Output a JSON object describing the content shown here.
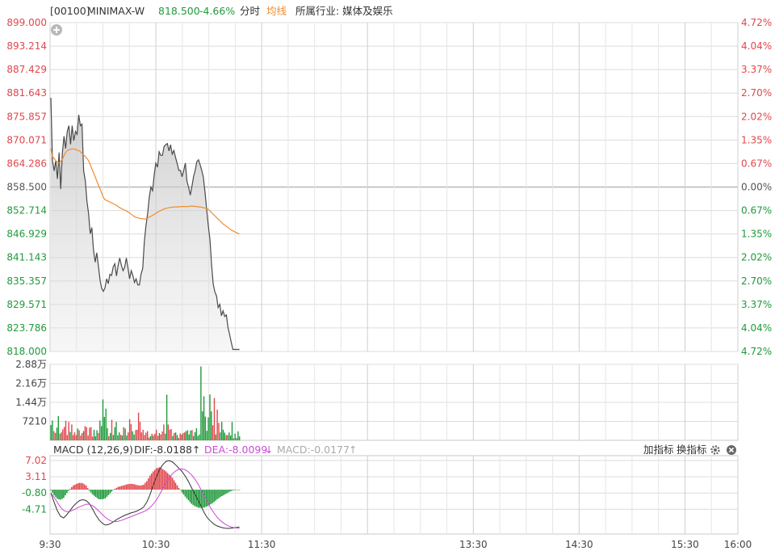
{
  "header": {
    "code": "[00100]",
    "name": "MINIMAX-W",
    "price": "818.500",
    "change": "-4.66%",
    "mode": "分时",
    "avg_label": "均线",
    "industry": "所属行业: 媒体及娱乐",
    "zoom_icon": "plus-circle-icon"
  },
  "macd_header": {
    "title": "MACD (12,26,9)",
    "dif": "DIF:-8.0188",
    "dif_arrow": "↑",
    "dea": "DEA:-8.0099",
    "dea_arrow": "↓",
    "macd": "MACD:-0.0177",
    "macd_arrow": "↑",
    "add_indicator": "加指标",
    "switch_indicator": "换指标",
    "settings_icon": "gear-icon",
    "close_icon": "close-circle-icon"
  },
  "colors": {
    "up": "#e0474c",
    "down": "#1f9a3b",
    "price_line": "#4a4a4a",
    "avg_line": "#f08c2e",
    "dea_line": "#c94bd6",
    "grid": "#d6d6d6"
  },
  "chart_data": [
    {
      "type": "line",
      "panel": "price",
      "x_ticks": [
        "9:30",
        "10:30",
        "11:30",
        "13:30",
        "14:30",
        "15:30",
        "16:00"
      ],
      "x_range": [
        "9:30",
        "16:00"
      ],
      "ylim": [
        818.0,
        899.0
      ],
      "y_ticks": [
        "899.000",
        "893.214",
        "887.429",
        "881.643",
        "875.857",
        "870.071",
        "864.286",
        "858.500",
        "852.714",
        "846.929",
        "841.143",
        "835.357",
        "829.571",
        "823.786",
        "818.000"
      ],
      "y_ticks_right": [
        "4.72%",
        "4.04%",
        "3.37%",
        "2.70%",
        "2.02%",
        "1.35%",
        "0.67%",
        "0.00%",
        "0.67%",
        "1.35%",
        "2.02%",
        "2.70%",
        "3.37%",
        "4.04%",
        "4.72%"
      ],
      "prev_close": 858.5,
      "series": [
        {
          "name": "price",
          "values": [
            880.5,
            865.0,
            862.5,
            865.0,
            860.5,
            867.0,
            858.0,
            866.8,
            871.0,
            868.0,
            872.2,
            873.6,
            869.0,
            873.6,
            869.9,
            872.2,
            871.5,
            876.3,
            873.6,
            874.0,
            862.5,
            860.0,
            855.0,
            852.0,
            847.0,
            848.5,
            843.0,
            840.0,
            842.3,
            839.0,
            835.5,
            833.5,
            832.8,
            833.6,
            835.9,
            834.7,
            837.0,
            836.7,
            838.8,
            839.6,
            836.6,
            839.2,
            841.0,
            839.2,
            837.9,
            838.7,
            841.0,
            838.6,
            835.9,
            837.9,
            836.7,
            835.0,
            835.9,
            834.4,
            834.4,
            837.0,
            838.5,
            845.0,
            849.0,
            852.0,
            856.0,
            858.5,
            857.6,
            861.5,
            864.4,
            863.4,
            867.2,
            866.3,
            866.3,
            868.5,
            868.9,
            869.2,
            867.4,
            868.9,
            866.6,
            867.5,
            865.8,
            864.4,
            862.6,
            862.6,
            861.0,
            862.6,
            864.4,
            859.9,
            858.4,
            856.5,
            858.6,
            861.1,
            862.6,
            864.7,
            865.2,
            864.0,
            862.6,
            860.9,
            857.1,
            853.0,
            849.0,
            845.5,
            839.3,
            834.6,
            832.6,
            831.7,
            828.8,
            829.6,
            826.8,
            828.0,
            826.6,
            827.0,
            823.9,
            822.1,
            820.2,
            818.5,
            818.5,
            818.5,
            818.5,
            818.5
          ]
        },
        {
          "name": "avg",
          "values": [
            868.0,
            866.0,
            865.5,
            865.0,
            864.6,
            864.4,
            864.8,
            865.3,
            866.3,
            867.0,
            867.5,
            867.7,
            867.8,
            867.9,
            867.9,
            867.8,
            867.6,
            867.5,
            867.2,
            866.8,
            866.4,
            866.0,
            865.5,
            865.0,
            864.0,
            863.0,
            862.0,
            861.0,
            860.0,
            859.0,
            858.0,
            857.0,
            856.0,
            855.4,
            855.2,
            855.0,
            854.8,
            854.6,
            854.4,
            854.2,
            854.0,
            853.7,
            853.4,
            853.2,
            853.0,
            852.8,
            852.6,
            852.4,
            852.1,
            851.8,
            851.5,
            851.2,
            851.0,
            850.9,
            850.8,
            850.7,
            850.7,
            850.6,
            850.7,
            850.9,
            851.1,
            851.3,
            851.5,
            851.8,
            852.0,
            852.3,
            852.5,
            852.7,
            852.9,
            853.1,
            853.2,
            853.3,
            853.4,
            853.5,
            853.5,
            853.6,
            853.6,
            853.6,
            853.6,
            853.7,
            853.7,
            853.7,
            853.7,
            853.7,
            853.7,
            853.8,
            853.8,
            853.8,
            853.7,
            853.7,
            853.6,
            853.6,
            853.5,
            853.4,
            853.3,
            853.2,
            853.0,
            852.6,
            852.2,
            851.8,
            851.4,
            851.0,
            850.6,
            850.2,
            849.8,
            849.4,
            849.1,
            848.8,
            848.5,
            848.2,
            847.9,
            847.7,
            847.5,
            847.3,
            847.1,
            847.0
          ]
        }
      ]
    },
    {
      "type": "bar",
      "panel": "volume",
      "ylim": [
        0,
        28800
      ],
      "y_ticks": [
        "2.88万",
        "2.16万",
        "1.44万",
        "7210"
      ],
      "values": [
        5800,
        7500,
        3500,
        2800,
        4800,
        9200,
        2500,
        3000,
        4200,
        5100,
        7400,
        2000,
        7000,
        3200,
        6000,
        2000,
        3000,
        2000,
        4500,
        3800,
        1800,
        2800,
        3500,
        5400,
        5000,
        1800,
        4800,
        5000,
        1400,
        4000,
        1500,
        3800,
        2800,
        7500,
        5400,
        15500,
        8900,
        12000,
        4600,
        1600,
        2800,
        7800,
        2000,
        5000,
        7000,
        1900,
        3000,
        2100,
        1800,
        5000,
        4500,
        1800,
        3000,
        8000,
        6100,
        3400,
        2200,
        3900,
        4000,
        10500,
        7000,
        3000,
        4000,
        2000,
        2900,
        3500,
        1000,
        1600,
        2500,
        1800,
        2500,
        4000,
        1700,
        2800,
        2200,
        3300,
        6000,
        2500,
        17300,
        6000,
        4000,
        4300,
        1700,
        2800,
        3000,
        2000,
        900,
        2600,
        2200,
        2800,
        3000,
        3500,
        3800,
        2200,
        3700,
        3900,
        1700,
        3100,
        4600,
        1700,
        2200,
        28000,
        11000,
        16700,
        9000,
        3600,
        8700,
        17400,
        11000,
        5700,
        16000,
        2200,
        11600,
        6600,
        3000,
        7000,
        4000,
        2900,
        2000,
        2000,
        3000,
        1800,
        7000,
        800,
        2500,
        900,
        3400,
        1500
      ],
      "colors": [
        "d",
        "d",
        "u",
        "u",
        "d",
        "d",
        "u",
        "d",
        "u",
        "u",
        "u",
        "u",
        "u",
        "d",
        "u",
        "u",
        "u",
        "u",
        "d",
        "u",
        "u",
        "u",
        "d",
        "u",
        "u",
        "u",
        "u",
        "u",
        "u",
        "d",
        "d",
        "d",
        "u",
        "d",
        "d",
        "d",
        "d",
        "d",
        "d",
        "u",
        "d",
        "u",
        "d",
        "d",
        "d",
        "d",
        "d",
        "u",
        "d",
        "u",
        "d",
        "d",
        "u",
        "u",
        "u",
        "d",
        "d",
        "u",
        "u",
        "u",
        "u",
        "u",
        "u",
        "u",
        "u",
        "u",
        "u",
        "d",
        "u",
        "d",
        "u",
        "u",
        "u",
        "d",
        "u",
        "u",
        "u",
        "d",
        "d",
        "u",
        "u",
        "u",
        "d",
        "u",
        "d",
        "d",
        "u",
        "u",
        "d",
        "u",
        "u",
        "d",
        "d",
        "d",
        "d",
        "u",
        "d",
        "d",
        "d",
        "d",
        "d",
        "d",
        "d",
        "d",
        "d",
        "d",
        "d",
        "d",
        "d",
        "u",
        "u",
        "d",
        "u",
        "u",
        "d",
        "d",
        "d",
        "d",
        "u",
        "d",
        "d",
        "d",
        "d",
        "u",
        "d",
        "d",
        "d",
        "d"
      ]
    },
    {
      "type": "bar",
      "panel": "macd",
      "ylim": [
        -9.5,
        7.02
      ],
      "y_ticks": [
        "7.02",
        "3.11",
        "-0.80",
        "-4.71"
      ],
      "zero": 0,
      "series": [
        {
          "name": "DIF",
          "values": [
            -0.8,
            -3.0,
            -5.0,
            -6.4,
            -6.8,
            -6.0,
            -5.0,
            -4.0,
            -3.2,
            -2.6,
            -2.4,
            -2.6,
            -3.3,
            -4.6,
            -6.0,
            -7.2,
            -8.0,
            -8.5,
            -8.4,
            -8.0,
            -7.5,
            -7.0,
            -6.6,
            -6.2,
            -5.9,
            -5.6,
            -5.4,
            -5.1,
            -4.7,
            -4.2,
            -3.0,
            -1.2,
            1.0,
            3.0,
            4.8,
            6.0,
            6.8,
            7.0,
            6.7,
            6.0,
            5.2,
            4.4,
            3.3,
            2.0,
            0.5,
            -1.0,
            -2.5,
            -4.0,
            -5.6,
            -6.8,
            -7.6,
            -8.3,
            -8.7,
            -9.0,
            -9.2,
            -9.3,
            -9.3,
            -9.2,
            -9.1,
            -9.0
          ]
        },
        {
          "name": "DEA",
          "values": [
            -0.8,
            -1.8,
            -3.0,
            -4.2,
            -5.0,
            -5.3,
            -5.2,
            -4.9,
            -4.5,
            -4.1,
            -3.8,
            -3.5,
            -3.5,
            -3.8,
            -4.4,
            -5.1,
            -5.9,
            -6.6,
            -7.2,
            -7.6,
            -7.7,
            -7.6,
            -7.4,
            -7.1,
            -6.8,
            -6.5,
            -6.2,
            -5.9,
            -5.6,
            -5.3,
            -4.9,
            -4.3,
            -3.5,
            -2.5,
            -1.2,
            0.2,
            1.6,
            2.8,
            3.8,
            4.5,
            4.9,
            5.0,
            4.8,
            4.3,
            3.6,
            2.6,
            1.4,
            0.0,
            -1.5,
            -3.0,
            -4.4,
            -5.6,
            -6.6,
            -7.4,
            -8.0,
            -8.5,
            -8.9,
            -9.1,
            -9.2,
            -9.3
          ]
        },
        {
          "name": "MACD",
          "values": [
            -0.3,
            -2.4,
            -4.0,
            -4.4,
            -3.6,
            -1.4,
            0.4,
            1.8,
            2.6,
            3.0,
            2.8,
            1.8,
            -0.4,
            -2.0,
            -3.2,
            -4.2,
            -4.2,
            -3.8,
            -2.4,
            -0.8,
            0.4,
            1.2,
            1.6,
            2.0,
            2.4,
            2.6,
            2.4,
            2.0,
            1.8,
            2.2,
            3.8,
            6.2,
            8.0,
            9.4,
            9.8,
            9.0,
            8.0,
            6.6,
            5.2,
            3.0,
            0.8,
            -1.2,
            -3.0,
            -4.6,
            -6.2,
            -7.2,
            -7.8,
            -8.0,
            -7.8,
            -7.2,
            -6.4,
            -5.4,
            -4.2,
            -3.2,
            -2.4,
            -1.6,
            -0.8,
            -0.3,
            -0.1,
            0.0
          ]
        }
      ]
    }
  ]
}
